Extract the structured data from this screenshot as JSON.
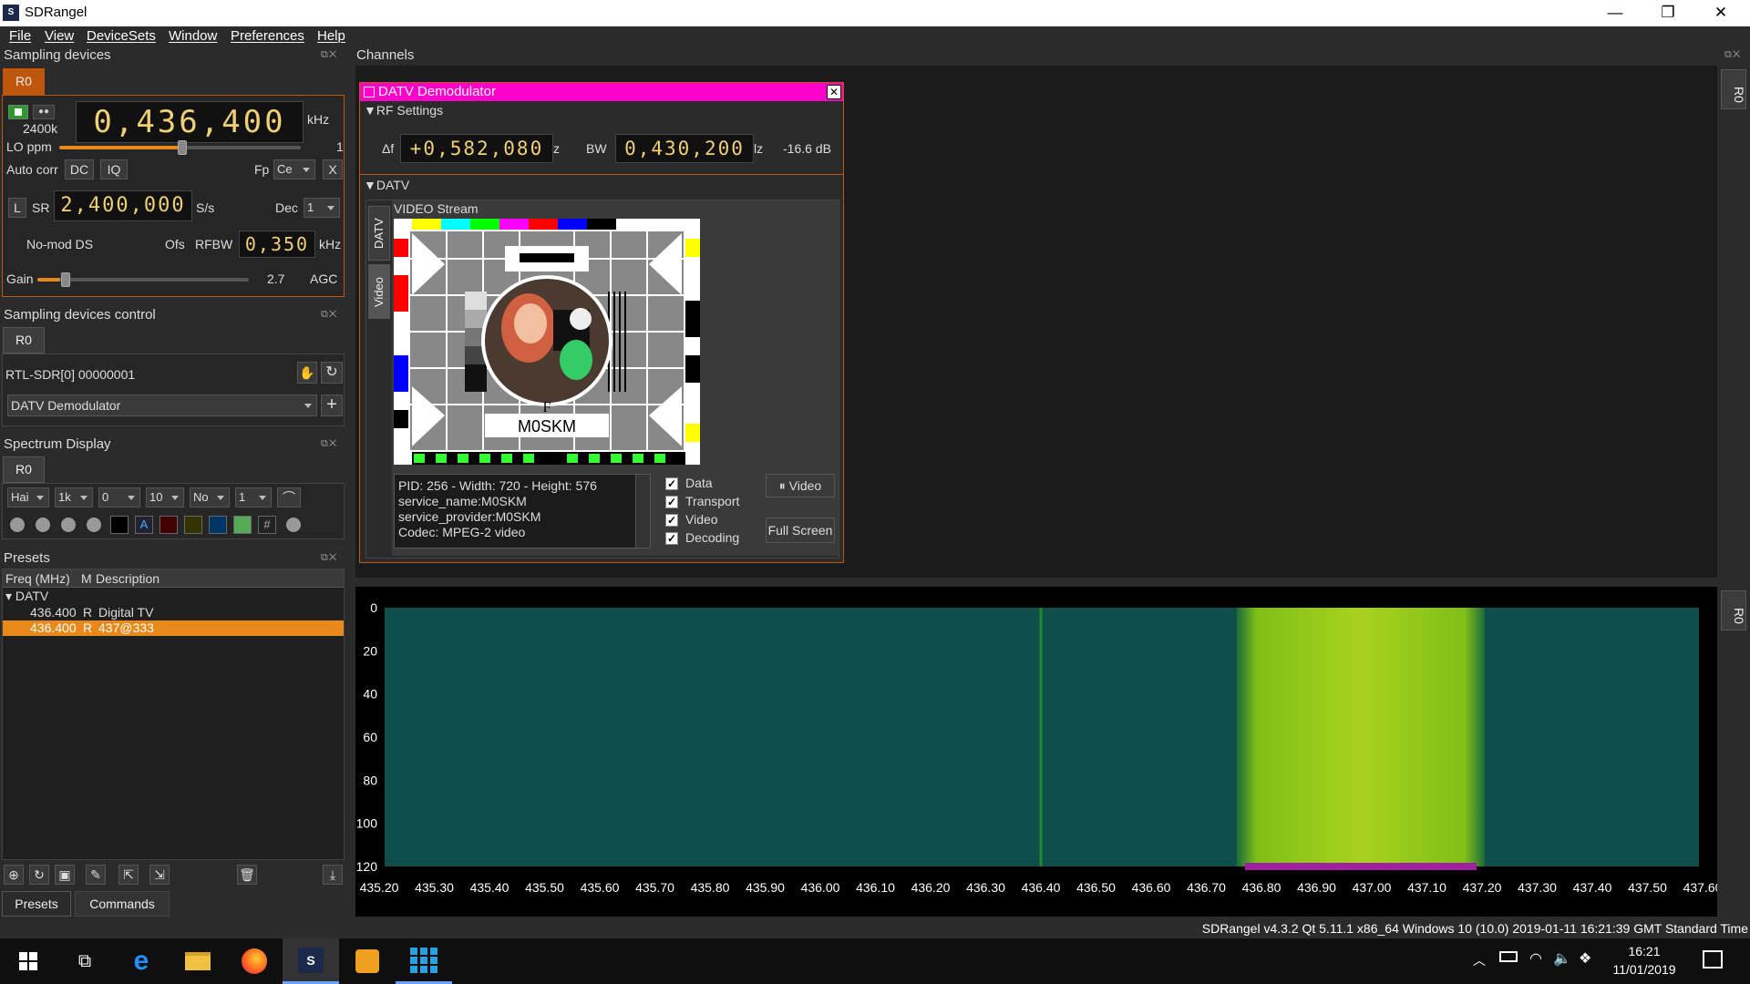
{
  "window": {
    "title": "SDRangel",
    "minimize": "—",
    "restore": "❐",
    "close": "✕"
  },
  "menu": [
    "File",
    "View",
    "DeviceSets",
    "Window",
    "Preferences",
    "Help"
  ],
  "sampling_devices": {
    "title": "Sampling devices",
    "tab": "R0",
    "frequency": "0,436,400",
    "freq_unit": "kHz",
    "rate": "2400k",
    "lo_ppm_label": "LO ppm",
    "lo_ppm_value": "1",
    "auto_corr": "Auto corr",
    "dc": "DC",
    "iq": "IQ",
    "fp": "Fp",
    "fp_value": "Ce",
    "x_label": "X",
    "l_label": "L",
    "sr_label": "SR",
    "sr_value": "2,400,000",
    "sr_unit": "S/s",
    "dec_label": "Dec",
    "dec_value": "1",
    "nomod": "No-mod DS",
    "ofs": "Ofs",
    "rfbw_label": "RFBW",
    "rfbw_value": "0,350",
    "rfbw_unit": "kHz",
    "gain_label": "Gain",
    "gain_value": "2.7",
    "agc": "AGC"
  },
  "sampling_control": {
    "title": "Sampling devices control",
    "tab": "R0",
    "device": "RTL-SDR[0] 00000001",
    "channel": "DATV Demodulator"
  },
  "spectrum_display": {
    "title": "Spectrum Display",
    "tab": "R0",
    "combos": [
      "Hai",
      "1k",
      "0",
      "10",
      "No",
      "1"
    ]
  },
  "presets": {
    "title": "Presets",
    "col_freq": "Freq (MHz)",
    "col_m": "M",
    "col_desc": "Description",
    "group": "DATV",
    "rows": [
      {
        "freq": "436.400",
        "m": "R",
        "desc": "Digital TV"
      },
      {
        "freq": "436.400",
        "m": "R",
        "desc": "437@333"
      }
    ],
    "bottom_tabs": [
      "Presets",
      "Commands"
    ]
  },
  "channels": {
    "title": "Channels",
    "side_tab": "R0"
  },
  "datv": {
    "title": "DATV Demodulator",
    "rf_settings": "RF Settings",
    "delta_f_label": "Δf",
    "delta_f_value": "+0,582,080",
    "delta_f_unit": "z",
    "bw_label": "BW",
    "bw_value": "0,430,200",
    "bw_unit": "lz",
    "level": "-16.6 dB",
    "section": "DATV",
    "vtab_datv": "DATV",
    "vtab_video": "Video",
    "stream_title": "VIDEO Stream",
    "callsign": "M0SKM",
    "letter_f": "F",
    "info": [
      "PID: 256 - Width: 720 - Height: 576",
      "service_name:M0SKM",
      "service_provider:M0SKM",
      "Codec: MPEG-2 video"
    ],
    "checks": [
      "Data",
      "Transport",
      "Video",
      "Decoding"
    ],
    "video_btn": "Video",
    "pause_glyph": "⏸",
    "fullscreen_btn": "Full Screen"
  },
  "waterfall": {
    "side_tab": "R0",
    "y_ticks": [
      "0",
      "20",
      "40",
      "60",
      "80",
      "100",
      "120"
    ],
    "x_ticks": [
      "435.20",
      "435.30",
      "435.40",
      "435.50",
      "435.60",
      "435.70",
      "435.80",
      "435.90",
      "436.00",
      "436.10",
      "436.20",
      "436.30",
      "436.40",
      "436.50",
      "436.60",
      "436.70",
      "436.80",
      "436.90",
      "437.00",
      "437.10",
      "437.20",
      "437.30",
      "437.40",
      "437.50",
      "437.60"
    ]
  },
  "status": "SDRangel v4.3.2 Qt 5.11.1 x86_64 Windows 10 (10.0) 2019-01-11 16:21:39 GMT Standard Time",
  "taskbar": {
    "time": "16:21",
    "date": "11/01/2019"
  },
  "colors": {
    "accent_orange": "#e8891a",
    "datv_title": "#ff00cc",
    "waterfall_bg": "#0f4a4a",
    "waterfall_signal": "#8fcf1a"
  }
}
